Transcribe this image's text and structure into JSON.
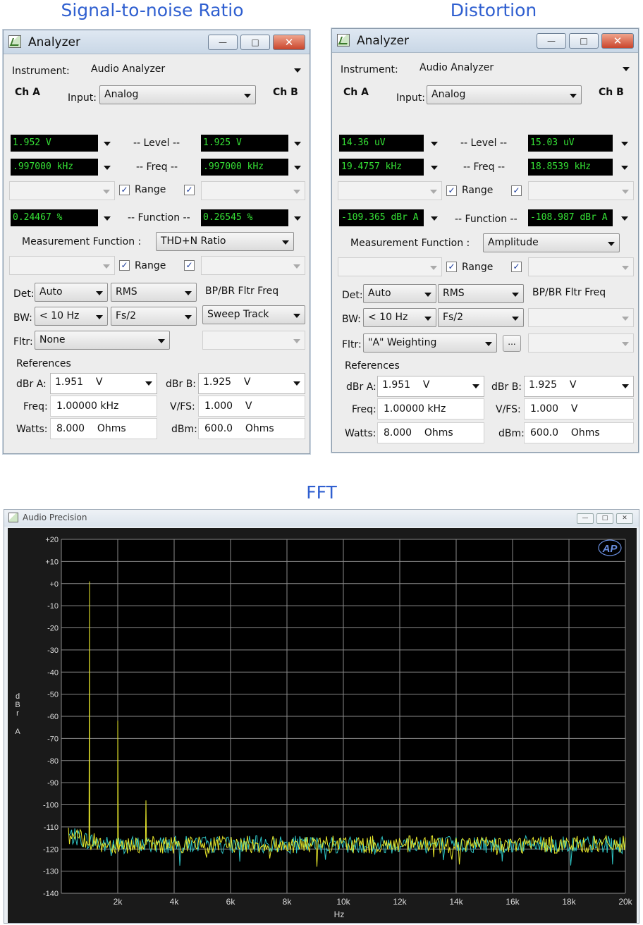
{
  "headings": {
    "snr": "Signal-to-noise Ratio",
    "distortion": "Distortion",
    "fft": "FFT"
  },
  "analyzer_left": {
    "title": "Analyzer",
    "instrument_label": "Instrument:",
    "instrument_value": "Audio Analyzer",
    "ch_a": "Ch A",
    "ch_b": "Ch B",
    "input_label": "Input:",
    "input_value": "Analog",
    "level_a": "1.952   V",
    "level_label": "-- Level --",
    "level_b": "1.925   V",
    "freq_a": ".997000 kHz",
    "freq_label": "-- Freq --",
    "freq_b": ".997000 kHz",
    "range_label_1": "Range",
    "func_a": "0.24467  %",
    "function_label": "-- Function --",
    "func_b": "0.26545  %",
    "meas_label": "Measurement Function :",
    "meas_value": "THD+N Ratio",
    "range_label_2": "Range",
    "det_label": "Det:",
    "det_value": "Auto",
    "rms_value": "RMS",
    "bpbr_label": "BP/BR Fltr Freq",
    "bw_label": "BW:",
    "bw_value": "< 10 Hz",
    "fs_value": "Fs/2",
    "sweep_value": "Sweep Track",
    "fltr_label": "Fltr:",
    "fltr_value": "None",
    "references_label": "References",
    "dbra_label": "dBr A:",
    "dbra_value": "1.951    V",
    "dbrb_label": "dBr B:",
    "dbrb_value": "1.925    V",
    "freq_ref_label": "Freq:",
    "freq_ref_value": "1.00000 kHz",
    "vfs_label": "V/FS:",
    "vfs_value": "1.000    V",
    "watts_label": "Watts:",
    "watts_value": "8.000    Ohms",
    "dbm_label": "dBm:",
    "dbm_value": "600.0    Ohms"
  },
  "analyzer_right": {
    "title": "Analyzer",
    "instrument_label": "Instrument:",
    "instrument_value": "Audio Analyzer",
    "ch_a": "Ch A",
    "ch_b": "Ch B",
    "input_label": "Input:",
    "input_value": "Analog",
    "level_a": "14.36  uV",
    "level_label": "-- Level --",
    "level_b": "15.03  uV",
    "freq_a": "19.4757 kHz",
    "freq_label": "-- Freq --",
    "freq_b": "18.8539 kHz",
    "range_label_1": "Range",
    "func_a": "-109.365 dBr A",
    "function_label": "-- Function --",
    "func_b": "-108.987 dBr A",
    "meas_label": "Measurement Function :",
    "meas_value": "Amplitude",
    "range_label_2": "Range",
    "det_label": "Det:",
    "det_value": "Auto",
    "rms_value": "RMS",
    "bpbr_label": "BP/BR Fltr Freq",
    "bw_label": "BW:",
    "bw_value": "< 10 Hz",
    "fs_value": "Fs/2",
    "fltr_label": "Fltr:",
    "fltr_value": "\"A\" Weighting",
    "ellipsis": "...",
    "references_label": "References",
    "dbra_label": "dBr A:",
    "dbra_value": "1.951    V",
    "dbrb_label": "dBr B:",
    "dbrb_value": "1.925    V",
    "freq_ref_label": "Freq:",
    "freq_ref_value": "1.00000 kHz",
    "vfs_label": "V/FS:",
    "vfs_value": "1.000    V",
    "watts_label": "Watts:",
    "watts_value": "8.000    Ohms",
    "dbm_label": "dBm:",
    "dbm_value": "600.0    Ohms"
  },
  "fft_window": {
    "title": "Audio Precision",
    "logo": "AP"
  },
  "chart_data": {
    "type": "line",
    "title": "",
    "xlabel": "Hz",
    "ylabel": "d B r   A",
    "xlim": [
      0,
      20000
    ],
    "ylim": [
      -140,
      20
    ],
    "x_ticks": [
      2000,
      4000,
      6000,
      8000,
      10000,
      12000,
      14000,
      16000,
      18000,
      20000
    ],
    "x_tick_labels": [
      "2k",
      "4k",
      "6k",
      "8k",
      "10k",
      "12k",
      "14k",
      "16k",
      "18k",
      "20k"
    ],
    "y_ticks": [
      20,
      10,
      0,
      -10,
      -20,
      -30,
      -40,
      -50,
      -60,
      -70,
      -80,
      -90,
      -100,
      -110,
      -120,
      -130,
      -140
    ],
    "y_tick_labels": [
      "+20",
      "+10",
      "+0",
      "-10",
      "-20",
      "-30",
      "-40",
      "-50",
      "-60",
      "-70",
      "-80",
      "-90",
      "-100",
      "-110",
      "-120",
      "-130",
      "-140"
    ],
    "grid": true,
    "background": "#000000",
    "grid_color": "#8a8a8a",
    "series": [
      {
        "color": "#e6e62a",
        "noise_floor": -118,
        "peaks": [
          {
            "x": 1000,
            "y": 1
          },
          {
            "x": 1000,
            "y": -28
          },
          {
            "x": 1000,
            "y": -85
          },
          {
            "x": 2000,
            "y": -62
          },
          {
            "x": 3000,
            "y": -98
          }
        ]
      },
      {
        "color": "#2ec4c4",
        "noise_floor": -118,
        "peaks": []
      }
    ]
  }
}
